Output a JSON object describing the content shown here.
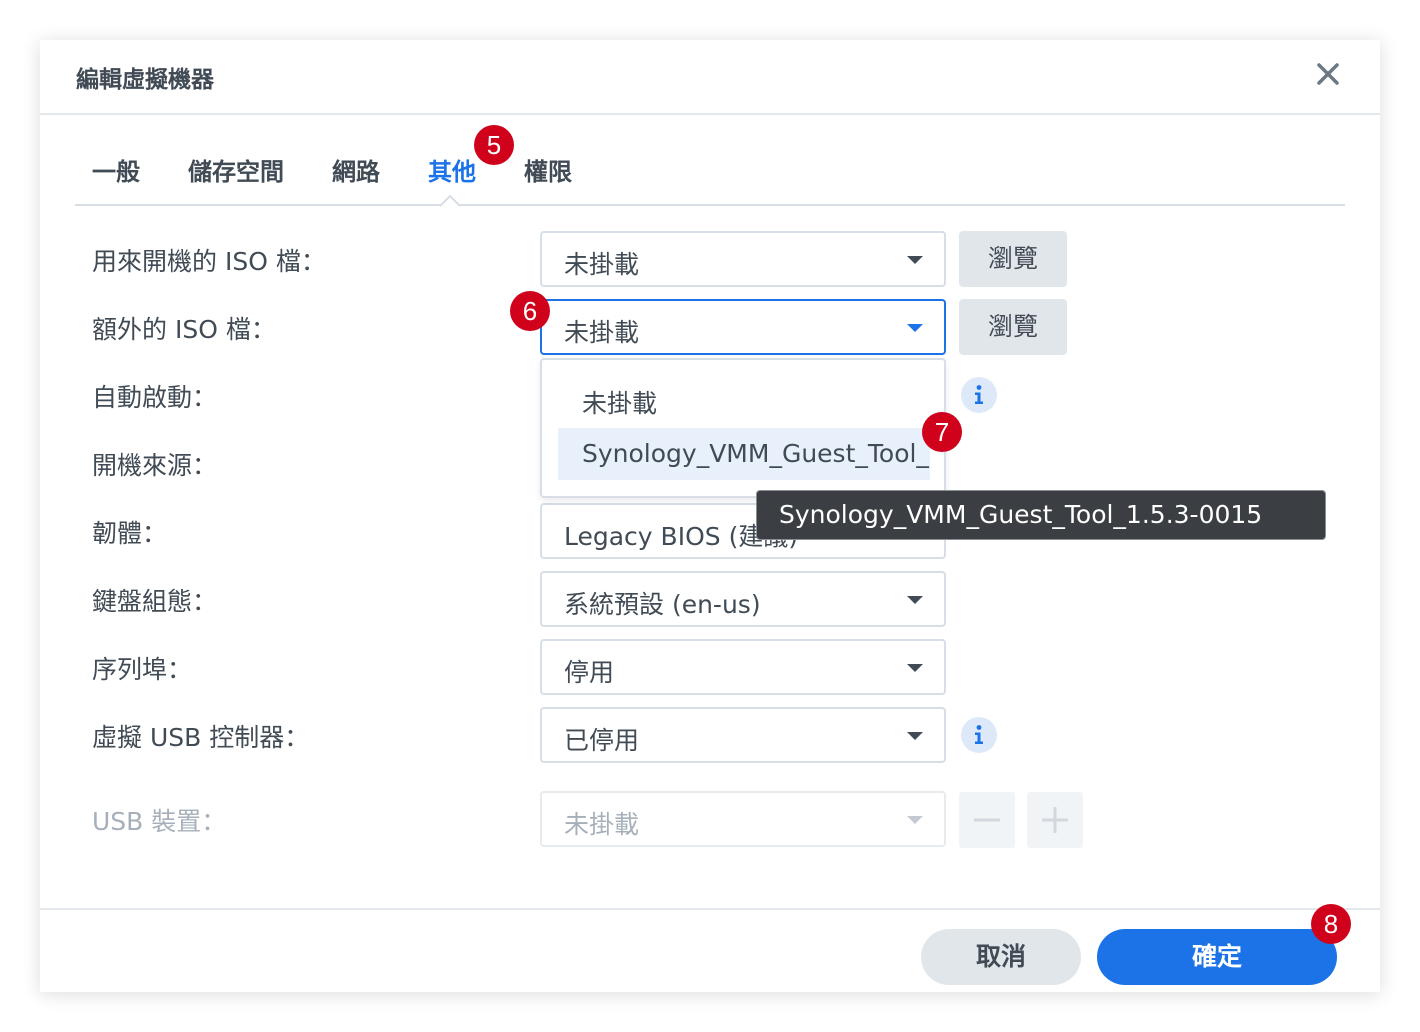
{
  "dialog": {
    "title": "編輯虛擬機器"
  },
  "tabs": [
    {
      "label": "一般"
    },
    {
      "label": "儲存空間"
    },
    {
      "label": "網路"
    },
    {
      "label": "其他"
    },
    {
      "label": "權限"
    }
  ],
  "active_tab": "其他",
  "form": {
    "boot_iso": {
      "label": "用來開機的 ISO 檔：",
      "value": "未掛載"
    },
    "extra_iso": {
      "label": "額外的 ISO 檔：",
      "value": "未掛載"
    },
    "browse_label": "瀏覽",
    "autostart": {
      "label": "自動啟動："
    },
    "boot_source": {
      "label": "開機來源："
    },
    "firmware": {
      "label": "韌體：",
      "value": "Legacy BIOS (建議)"
    },
    "keyboard": {
      "label": "鍵盤組態：",
      "value": "系統預設 (en-us)"
    },
    "serial_port": {
      "label": "序列埠：",
      "value": "停用"
    },
    "usb_controller": {
      "label": "虛擬 USB 控制器：",
      "value": "已停用"
    },
    "usb_device": {
      "label": "USB 裝置：",
      "value": "未掛載"
    }
  },
  "dropdown": {
    "options": [
      "未掛載",
      "Synology_VMM_Guest_Tool_1.5.3-0015"
    ],
    "hovered_index": 1
  },
  "tooltip": {
    "text": "Synology_VMM_Guest_Tool_1.5.3-0015"
  },
  "footer": {
    "cancel_label": "取消",
    "ok_label": "確定"
  },
  "steps": {
    "tab": "5",
    "select": "6",
    "option": "7",
    "confirm": "8"
  },
  "colors": {
    "accent": "#1c73e8",
    "badge": "#d0021b",
    "text": "#414b55",
    "disabled_text": "#a7b0ba"
  },
  "icons": {
    "close": "close-icon",
    "info": "info-icon",
    "dropdown": "chevron-down-icon",
    "minus": "minus-icon",
    "plus": "plus-icon"
  }
}
